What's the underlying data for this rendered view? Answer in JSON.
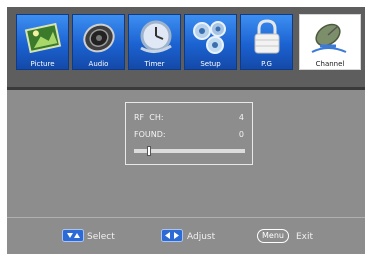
{
  "menu": {
    "tabs": [
      {
        "label": "Picture",
        "icon": "picture-icon"
      },
      {
        "label": "Audio",
        "icon": "speaker-icon"
      },
      {
        "label": "Timer",
        "icon": "clock-icon"
      },
      {
        "label": "Setup",
        "icon": "gears-icon"
      },
      {
        "label": "P.G",
        "icon": "lock-icon"
      },
      {
        "label": "Channel",
        "icon": "satellite-dish-icon"
      }
    ],
    "active_tab": "Channel"
  },
  "scan": {
    "rf_label": "RF  CH:",
    "rf_value": "4",
    "found_label": "FOUND:",
    "found_value": "0",
    "progress": 0.12
  },
  "footer": {
    "select_label": "Select",
    "adjust_label": "Adjust",
    "menu_key": "Menu",
    "exit_label": "Exit"
  },
  "colors": {
    "tab_blue": "#1b62d1",
    "screen_bg": "#8d8d8d",
    "active_tab_bg": "#ffffff"
  }
}
